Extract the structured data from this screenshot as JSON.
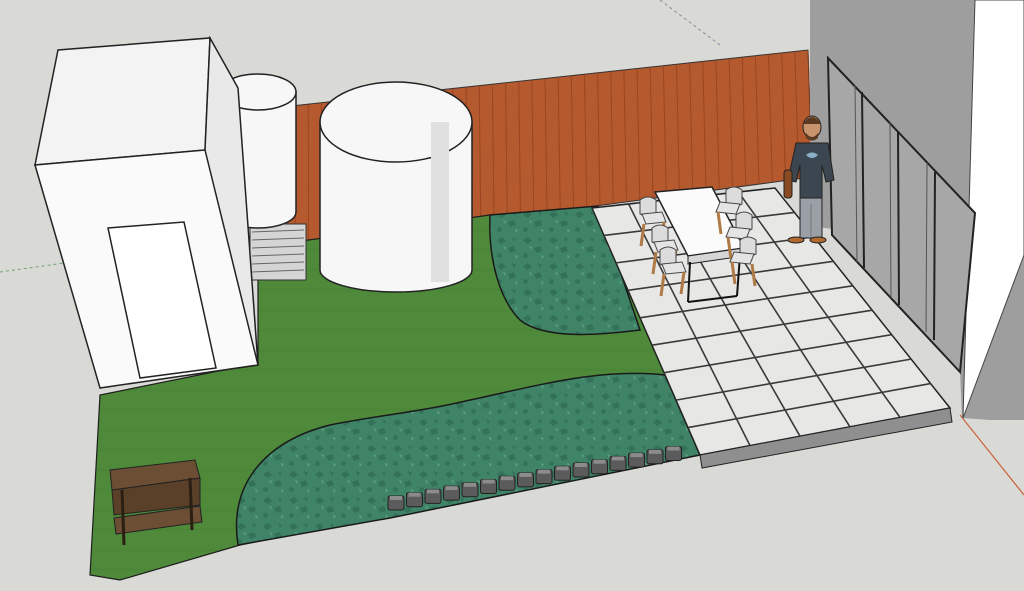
{
  "scene": {
    "colors": {
      "background": "#d9d9d6",
      "lawn": "#4f8a3a",
      "lawn_shade": "#467d33",
      "gravel": "#3f8467",
      "gravel_dark": "#2e6a52",
      "paving": "#e7e7e5",
      "paving_joint": "#3a3a3a",
      "fence": "#b5592e",
      "fence_dark": "#8e3f1d",
      "shed": "#fafafa",
      "tank": "#f7f7f7",
      "house_wall": "#9e9e9e",
      "bench_wood": "#6b4e33",
      "edging": "#5b5b5b",
      "axis_red": "#c8643c"
    },
    "objects": [
      "garden-shed",
      "slim-rain-tank",
      "round-water-tank",
      "timber-fence",
      "lawn",
      "gravel-bed",
      "paved-patio",
      "dining-table",
      "dining-chairs",
      "person-figure",
      "picnic-bench",
      "sleeper-edging",
      "house-wall",
      "sliding-doors"
    ]
  }
}
